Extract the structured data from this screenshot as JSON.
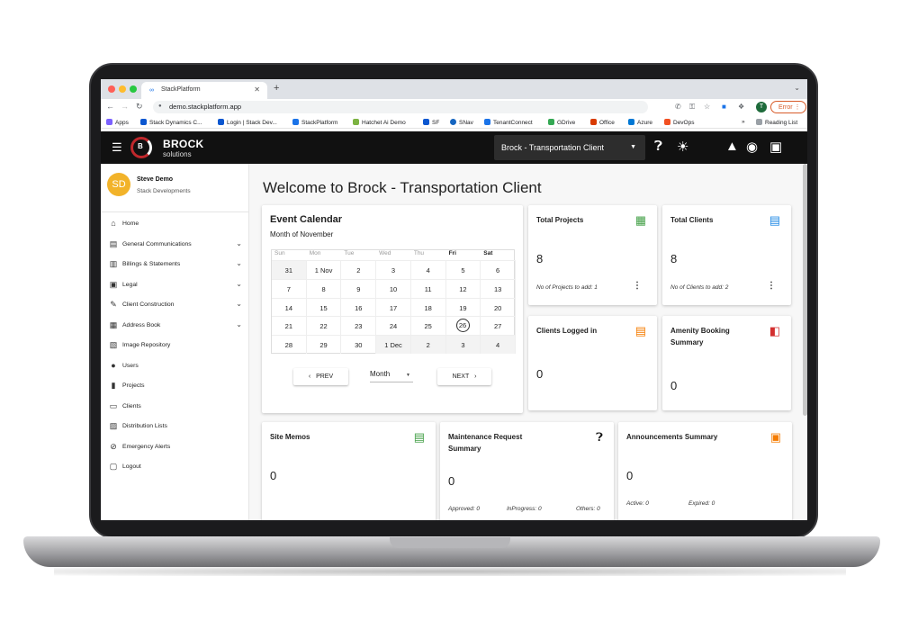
{
  "browser": {
    "tab_title": "StackPlatform",
    "url": "demo.stackplatform.app",
    "profile_initial": "T",
    "error_label": "Error",
    "bookmarks": [
      "Apps",
      "Stack Dynamics C...",
      "Login | Stack Dev...",
      "StackPlatform",
      "Hatchet Ai Demo",
      "SF",
      "SNav",
      "TenantConnect",
      "GDrive",
      "Office",
      "Azure",
      "DevOps"
    ],
    "reading_list": "Reading List"
  },
  "header": {
    "brand_name": "BROCK",
    "brand_sub": "solutions",
    "brand_mark": "B",
    "client_selected": "Brock - Transportation Client"
  },
  "user": {
    "initials": "SD",
    "name": "Steve Demo",
    "company": "Stack Developments"
  },
  "nav": [
    {
      "label": "Home",
      "icon": "home-icon",
      "expandable": false
    },
    {
      "label": "General Communications",
      "icon": "forum-icon",
      "expandable": true
    },
    {
      "label": "Billings & Statements",
      "icon": "bank-icon",
      "expandable": true
    },
    {
      "label": "Legal",
      "icon": "legal-icon",
      "expandable": true
    },
    {
      "label": "Client Construction",
      "icon": "wrench-icon",
      "expandable": true
    },
    {
      "label": "Address Book",
      "icon": "contacts-icon",
      "expandable": true
    },
    {
      "label": "Image Repository",
      "icon": "image-icon",
      "expandable": false
    },
    {
      "label": "Users",
      "icon": "users-icon",
      "expandable": false
    },
    {
      "label": "Projects",
      "icon": "city-icon",
      "expandable": false
    },
    {
      "label": "Clients",
      "icon": "store-icon",
      "expandable": false
    },
    {
      "label": "Distribution Lists",
      "icon": "contact-card-icon",
      "expandable": false
    },
    {
      "label": "Emergency Alerts",
      "icon": "alert-icon",
      "expandable": false
    },
    {
      "label": "Logout",
      "icon": "lock-icon",
      "expandable": false
    }
  ],
  "main": {
    "title": "Welcome to Brock - Transportation Client"
  },
  "calendar": {
    "title": "Event Calendar",
    "subtitle": "Month of November",
    "weekdays": [
      "Sun",
      "Mon",
      "Tue",
      "Wed",
      "Thu",
      "Fri",
      "Sat"
    ],
    "weeks": [
      [
        "31",
        "1   Nov",
        "2",
        "3",
        "4",
        "5",
        "6"
      ],
      [
        "7",
        "8",
        "9",
        "10",
        "11",
        "12",
        "13"
      ],
      [
        "14",
        "15",
        "16",
        "17",
        "18",
        "19",
        "20"
      ],
      [
        "21",
        "22",
        "23",
        "24",
        "25",
        "26",
        "27"
      ],
      [
        "28",
        "29",
        "30",
        "1   Dec",
        "2",
        "3",
        "4"
      ]
    ],
    "today": "26",
    "prev_label": "PREV",
    "next_label": "NEXT",
    "view_selected": "Month"
  },
  "cards": {
    "total_projects": {
      "title": "Total Projects",
      "value": "8",
      "foot": "No of Projects to add: 1",
      "icon": "city-icon",
      "color": "#43a047"
    },
    "total_clients": {
      "title": "Total Clients",
      "value": "8",
      "foot": "No of Clients to add: 2",
      "icon": "store-icon",
      "color": "#1e88e5"
    },
    "clients_logged_in": {
      "title": "Clients Logged in",
      "value": "0",
      "icon": "store-icon",
      "color": "#f57c00"
    },
    "amenity_booking": {
      "title": "Amenity Booking Summary",
      "value": "0",
      "icon": "door-icon",
      "color": "#d32f2f"
    },
    "site_memos": {
      "title": "Site Memos",
      "value": "0",
      "icon": "list-icon",
      "color": "#43a047"
    },
    "maintenance": {
      "title": "Maintenance Request Summary",
      "value": "0",
      "icon": "help-icon",
      "color": "#111111",
      "approved": "Approved: 0",
      "inprogress": "InProgress: 0",
      "others": "Others: 0"
    },
    "announcements": {
      "title": "Announcements Summary",
      "value": "0",
      "icon": "message-icon",
      "color": "#f57c00",
      "active": "Active: 0",
      "expired": "Expired: 0"
    }
  }
}
